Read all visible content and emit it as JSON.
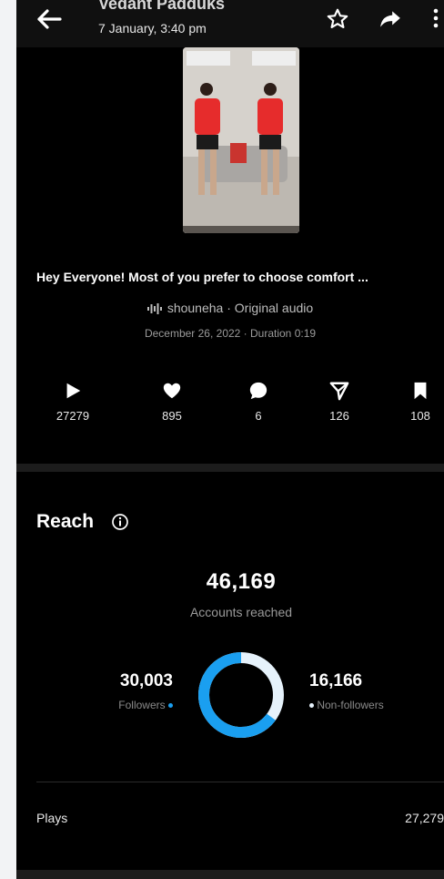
{
  "header": {
    "title": "Vedant Padduks",
    "subtitle": "7 January, 3:40 pm",
    "icons": [
      "back-arrow-icon",
      "star-icon",
      "share-icon",
      "more-vertical-icon"
    ]
  },
  "post": {
    "caption": "Hey Everyone! Most of you prefer to choose comfort ...",
    "audio": "shouneha · Original audio",
    "meta": "December 26, 2022 · Duration 0:19"
  },
  "stats": [
    {
      "icon": "play-icon",
      "value": "27279"
    },
    {
      "icon": "heart-icon",
      "value": "895"
    },
    {
      "icon": "comment-icon",
      "value": "6"
    },
    {
      "icon": "send-icon",
      "value": "126"
    },
    {
      "icon": "bookmark-icon",
      "value": "108"
    }
  ],
  "reach": {
    "title": "Reach",
    "accounts_reached": "46,169",
    "accounts_reached_label": "Accounts reached",
    "followers_value": "30,003",
    "followers_label": "Followers",
    "non_followers_value": "16,166",
    "non_followers_label": "Non-followers",
    "followers_share": 0.65,
    "colors": {
      "followers": "#1a9ff0",
      "non_followers": "#e6f2fb"
    }
  },
  "plays": {
    "label": "Plays",
    "value": "27,279"
  }
}
